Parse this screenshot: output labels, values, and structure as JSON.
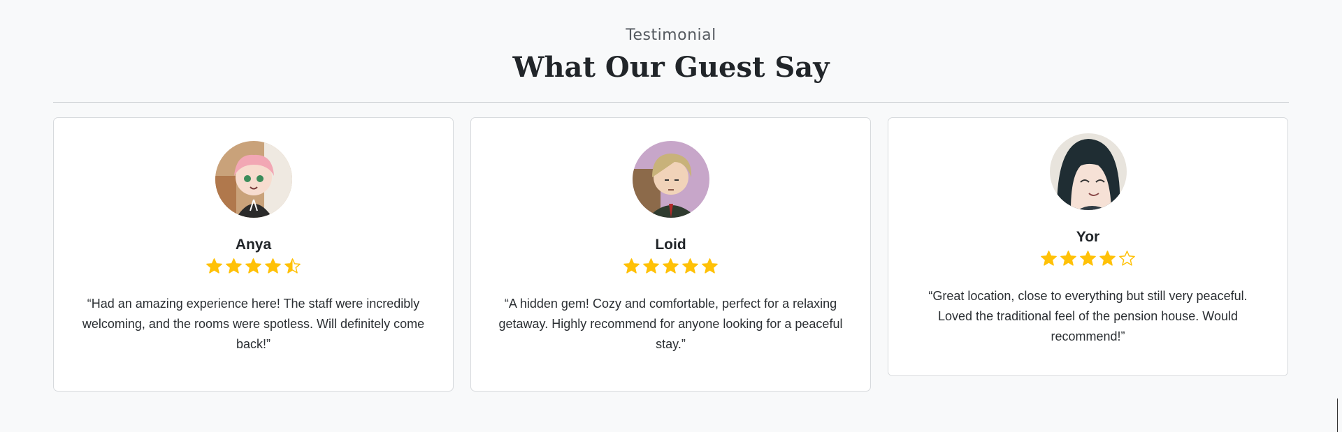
{
  "section": {
    "eyebrow": "Testimonial",
    "title": "What Our Guest Say"
  },
  "testimonials": [
    {
      "name": "Anya",
      "rating": 4.5,
      "quote": "“Had an amazing experience here! The staff were incredibly welcoming, and the rooms were spotless. Will definitely come back!”",
      "avatar_colors": {
        "background": "#c9a27a",
        "hair": "#f2a7b4",
        "clothing": "#2a2a2a"
      }
    },
    {
      "name": "Loid",
      "rating": 5,
      "quote": "“A hidden gem! Cozy and comfortable, perfect for a relaxing getaway. Highly recommend for anyone looking for a peaceful stay.”",
      "avatar_colors": {
        "background": "#c7a6c9",
        "hair": "#c8b27a",
        "clothing": "#2f3b2f"
      }
    },
    {
      "name": "Yor",
      "rating": 4,
      "quote": "“Great location, close to everything but still very peaceful. Loved the traditional feel of the pension house. Would recommend!”",
      "avatar_colors": {
        "background": "#e8e4dd",
        "hair": "#1f2d33",
        "clothing": "#2f3b44"
      }
    }
  ],
  "colors": {
    "star": "#ffc107",
    "page_background": "#f8f9fa",
    "card_border": "#d7dadd"
  },
  "icons": [
    "star-full-icon",
    "star-half-icon",
    "star-empty-icon"
  ]
}
